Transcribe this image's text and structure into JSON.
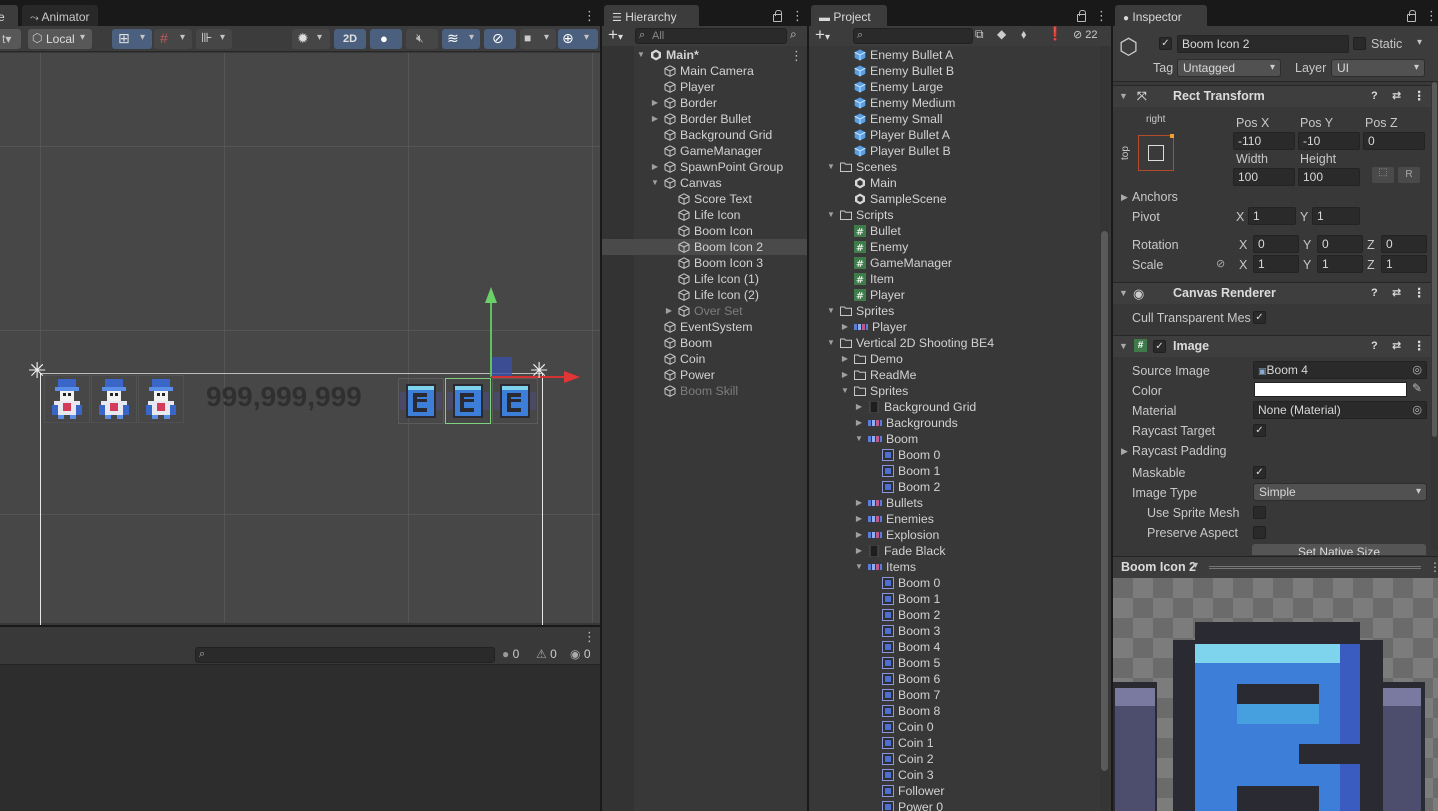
{
  "scene": {
    "tab_partial": "e",
    "animator_tab": "Animator",
    "local_label": "Local",
    "mode_2d": "2D",
    "score_text": "999,999,999",
    "console_counts": [
      "0",
      "0",
      "0"
    ]
  },
  "hierarchy": {
    "tab": "Hierarchy",
    "search_placeholder": "All",
    "items": [
      {
        "label": "Main*",
        "indent": 0,
        "arrow": "▼",
        "icon": "unity",
        "bold": true
      },
      {
        "label": "Main Camera",
        "indent": 1,
        "arrow": "",
        "icon": "cube"
      },
      {
        "label": "Player",
        "indent": 1,
        "arrow": "",
        "icon": "cube"
      },
      {
        "label": "Border",
        "indent": 1,
        "arrow": "▶",
        "icon": "cube"
      },
      {
        "label": "Border Bullet",
        "indent": 1,
        "arrow": "▶",
        "icon": "cube"
      },
      {
        "label": "Background Grid",
        "indent": 1,
        "arrow": "",
        "icon": "cube"
      },
      {
        "label": "GameManager",
        "indent": 1,
        "arrow": "",
        "icon": "cube"
      },
      {
        "label": "SpawnPoint Group",
        "indent": 1,
        "arrow": "▶",
        "icon": "cube"
      },
      {
        "label": "Canvas",
        "indent": 1,
        "arrow": "▼",
        "icon": "cube"
      },
      {
        "label": "Score Text",
        "indent": 2,
        "arrow": "",
        "icon": "cube"
      },
      {
        "label": "Life Icon",
        "indent": 2,
        "arrow": "",
        "icon": "cube"
      },
      {
        "label": "Boom Icon",
        "indent": 2,
        "arrow": "",
        "icon": "cube"
      },
      {
        "label": "Boom Icon 2",
        "indent": 2,
        "arrow": "",
        "icon": "cube",
        "selected": true
      },
      {
        "label": "Boom Icon 3",
        "indent": 2,
        "arrow": "",
        "icon": "cube"
      },
      {
        "label": "Life Icon (1)",
        "indent": 2,
        "arrow": "",
        "icon": "cube"
      },
      {
        "label": "Life Icon (2)",
        "indent": 2,
        "arrow": "",
        "icon": "cube"
      },
      {
        "label": "Over Set",
        "indent": 2,
        "arrow": "▶",
        "icon": "cube",
        "dim": true
      },
      {
        "label": "EventSystem",
        "indent": 1,
        "arrow": "",
        "icon": "cube"
      },
      {
        "label": "Boom",
        "indent": 1,
        "arrow": "",
        "icon": "cube"
      },
      {
        "label": "Coin",
        "indent": 1,
        "arrow": "",
        "icon": "cube"
      },
      {
        "label": "Power",
        "indent": 1,
        "arrow": "",
        "icon": "cube"
      },
      {
        "label": "Boom Skill",
        "indent": 1,
        "arrow": "",
        "icon": "cube",
        "dim": true
      }
    ]
  },
  "project": {
    "tab": "Project",
    "hidden_count": "22",
    "items": [
      {
        "label": "Enemy Bullet A",
        "indent": 1,
        "arrow": "",
        "icon": "prefab"
      },
      {
        "label": "Enemy Bullet B",
        "indent": 1,
        "arrow": "",
        "icon": "prefab"
      },
      {
        "label": "Enemy Large",
        "indent": 1,
        "arrow": "",
        "icon": "prefab"
      },
      {
        "label": "Enemy Medium",
        "indent": 1,
        "arrow": "",
        "icon": "prefab"
      },
      {
        "label": "Enemy Small",
        "indent": 1,
        "arrow": "",
        "icon": "prefab"
      },
      {
        "label": "Player Bullet A",
        "indent": 1,
        "arrow": "",
        "icon": "prefab"
      },
      {
        "label": "Player Bullet B",
        "indent": 1,
        "arrow": "",
        "icon": "prefab"
      },
      {
        "label": "Scenes",
        "indent": 0,
        "arrow": "▼",
        "icon": "folder"
      },
      {
        "label": "Main",
        "indent": 1,
        "arrow": "",
        "icon": "unity"
      },
      {
        "label": "SampleScene",
        "indent": 1,
        "arrow": "",
        "icon": "unity"
      },
      {
        "label": "Scripts",
        "indent": 0,
        "arrow": "▼",
        "icon": "folder"
      },
      {
        "label": "Bullet",
        "indent": 1,
        "arrow": "",
        "icon": "script"
      },
      {
        "label": "Enemy",
        "indent": 1,
        "arrow": "",
        "icon": "script"
      },
      {
        "label": "GameManager",
        "indent": 1,
        "arrow": "",
        "icon": "script"
      },
      {
        "label": "Item",
        "indent": 1,
        "arrow": "",
        "icon": "script"
      },
      {
        "label": "Player",
        "indent": 1,
        "arrow": "",
        "icon": "script"
      },
      {
        "label": "Sprites",
        "indent": 0,
        "arrow": "▼",
        "icon": "folder"
      },
      {
        "label": "Player",
        "indent": 1,
        "arrow": "▶",
        "icon": "sprite-sheet"
      },
      {
        "label": "Vertical 2D Shooting BE4",
        "indent": 0,
        "arrow": "▼",
        "icon": "folder"
      },
      {
        "label": "Demo",
        "indent": 1,
        "arrow": "▶",
        "icon": "folder"
      },
      {
        "label": "ReadMe",
        "indent": 1,
        "arrow": "▶",
        "icon": "folder"
      },
      {
        "label": "Sprites",
        "indent": 1,
        "arrow": "▼",
        "icon": "folder"
      },
      {
        "label": "Background Grid",
        "indent": 2,
        "arrow": "▶",
        "icon": "sprite-dark"
      },
      {
        "label": "Backgrounds",
        "indent": 2,
        "arrow": "▶",
        "icon": "sprite-sheet"
      },
      {
        "label": "Boom",
        "indent": 2,
        "arrow": "▼",
        "icon": "sprite-sheet"
      },
      {
        "label": "Boom 0",
        "indent": 3,
        "arrow": "",
        "icon": "sprite"
      },
      {
        "label": "Boom 1",
        "indent": 3,
        "arrow": "",
        "icon": "sprite"
      },
      {
        "label": "Boom 2",
        "indent": 3,
        "arrow": "",
        "icon": "sprite"
      },
      {
        "label": "Bullets",
        "indent": 2,
        "arrow": "▶",
        "icon": "sprite-sheet"
      },
      {
        "label": "Enemies",
        "indent": 2,
        "arrow": "▶",
        "icon": "sprite-sheet"
      },
      {
        "label": "Explosion",
        "indent": 2,
        "arrow": "▶",
        "icon": "sprite-sheet"
      },
      {
        "label": "Fade Black",
        "indent": 2,
        "arrow": "▶",
        "icon": "sprite-dark"
      },
      {
        "label": "Items",
        "indent": 2,
        "arrow": "▼",
        "icon": "sprite-sheet"
      },
      {
        "label": "Boom 0",
        "indent": 3,
        "arrow": "",
        "icon": "sprite"
      },
      {
        "label": "Boom 1",
        "indent": 3,
        "arrow": "",
        "icon": "sprite"
      },
      {
        "label": "Boom 2",
        "indent": 3,
        "arrow": "",
        "icon": "sprite"
      },
      {
        "label": "Boom 3",
        "indent": 3,
        "arrow": "",
        "icon": "sprite"
      },
      {
        "label": "Boom 4",
        "indent": 3,
        "arrow": "",
        "icon": "sprite"
      },
      {
        "label": "Boom 5",
        "indent": 3,
        "arrow": "",
        "icon": "sprite"
      },
      {
        "label": "Boom 6",
        "indent": 3,
        "arrow": "",
        "icon": "sprite"
      },
      {
        "label": "Boom 7",
        "indent": 3,
        "arrow": "",
        "icon": "sprite"
      },
      {
        "label": "Boom 8",
        "indent": 3,
        "arrow": "",
        "icon": "sprite"
      },
      {
        "label": "Coin 0",
        "indent": 3,
        "arrow": "",
        "icon": "sprite"
      },
      {
        "label": "Coin 1",
        "indent": 3,
        "arrow": "",
        "icon": "sprite"
      },
      {
        "label": "Coin 2",
        "indent": 3,
        "arrow": "",
        "icon": "sprite"
      },
      {
        "label": "Coin 3",
        "indent": 3,
        "arrow": "",
        "icon": "sprite"
      },
      {
        "label": "Follower",
        "indent": 3,
        "arrow": "",
        "icon": "sprite"
      },
      {
        "label": "Power 0",
        "indent": 3,
        "arrow": "",
        "icon": "sprite"
      }
    ]
  },
  "inspector": {
    "tab": "Inspector",
    "object_name": "Boom Icon 2",
    "static_label": "Static",
    "tag_label": "Tag",
    "tag_value": "Untagged",
    "layer_label": "Layer",
    "layer_value": "UI",
    "rect_transform": {
      "title": "Rect Transform",
      "anchor_h": "right",
      "anchor_v": "top",
      "pos_x_label": "Pos X",
      "pos_x": "-110",
      "pos_y_label": "Pos Y",
      "pos_y": "-10",
      "pos_z_label": "Pos Z",
      "pos_z": "0",
      "width_label": "Width",
      "width": "100",
      "height_label": "Height",
      "height": "100",
      "r_button": "R",
      "anchors_label": "Anchors",
      "pivot_label": "Pivot",
      "pivot_x": "1",
      "pivot_y": "1",
      "rotation_label": "Rotation",
      "rot_x": "0",
      "rot_y": "0",
      "rot_z": "0",
      "scale_label": "Scale",
      "scale_x": "1",
      "scale_y": "1",
      "scale_z": "1",
      "x": "X",
      "y": "Y",
      "z": "Z"
    },
    "canvas_renderer": {
      "title": "Canvas Renderer",
      "cull_label": "Cull Transparent Mes"
    },
    "image": {
      "title": "Image",
      "source_label": "Source Image",
      "source_value": "Boom 4",
      "color_label": "Color",
      "color_value": "#ffffff",
      "material_label": "Material",
      "material_value": "None (Material)",
      "raycast_target_label": "Raycast Target",
      "raycast_padding_label": "Raycast Padding",
      "maskable_label": "Maskable",
      "image_type_label": "Image Type",
      "image_type_value": "Simple",
      "use_sprite_mesh_label": "Use Sprite Mesh",
      "preserve_aspect_label": "Preserve Aspect",
      "set_native_size": "Set Native Size"
    },
    "preview": {
      "title": "Boom Icon 2"
    }
  }
}
